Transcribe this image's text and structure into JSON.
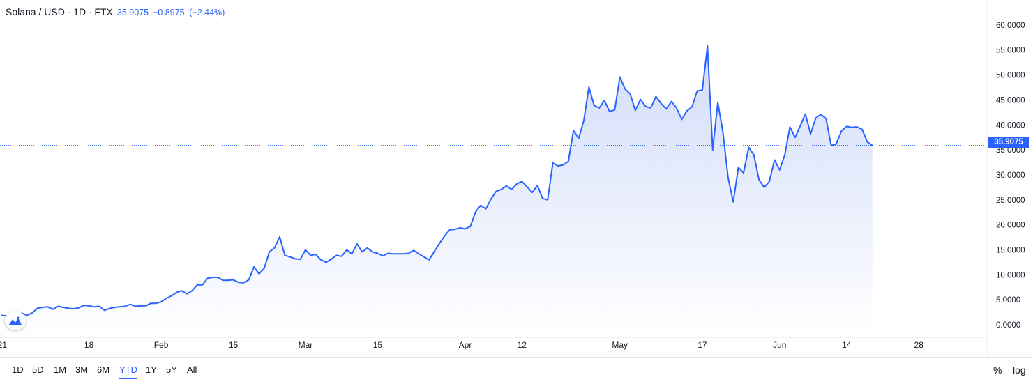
{
  "header": {
    "symbol": "Solana / USD",
    "interval": "1D",
    "exchange": "FTX",
    "last": "35.9075",
    "change": "−0.8975",
    "change_pct": "(−2.44%)"
  },
  "toolbar": {
    "ranges": [
      "1D",
      "5D",
      "1M",
      "3M",
      "6M",
      "YTD",
      "1Y",
      "5Y",
      "All"
    ],
    "active_range": "YTD",
    "percent_label": "%",
    "log_label": "log"
  },
  "price_tag": "35.9075",
  "colors": {
    "line": "#2962ff",
    "fill_top": "#d2dcf9",
    "fill_bottom": "#ffffff",
    "grid": "#e0e3eb",
    "text": "#131722"
  },
  "chart_data": {
    "type": "area",
    "ylim": [
      -2.5,
      65
    ],
    "y_ticks": [
      "60.0000",
      "55.0000",
      "50.0000",
      "45.0000",
      "40.0000",
      "35.0000",
      "30.0000",
      "25.0000",
      "20.0000",
      "15.0000",
      "10.0000",
      "5.0000",
      "0.0000"
    ],
    "x_ticks": [
      {
        "date": "2021-01-01",
        "label": "2021"
      },
      {
        "date": "2021-01-18",
        "label": "18"
      },
      {
        "date": "2021-02-01",
        "label": "Feb"
      },
      {
        "date": "2021-02-15",
        "label": "15"
      },
      {
        "date": "2021-03-01",
        "label": "Mar"
      },
      {
        "date": "2021-03-15",
        "label": "15"
      },
      {
        "date": "2021-04-01",
        "label": "Apr"
      },
      {
        "date": "2021-04-12",
        "label": "12"
      },
      {
        "date": "2021-05-01",
        "label": "May"
      },
      {
        "date": "2021-05-17",
        "label": "17"
      },
      {
        "date": "2021-06-01",
        "label": "Jun"
      },
      {
        "date": "2021-06-14",
        "label": "14"
      },
      {
        "date": "2021-06-28",
        "label": "28"
      }
    ],
    "last_value": 35.9075,
    "series": [
      {
        "x": [
          "2021-01-01",
          "2021-01-02",
          "2021-01-03",
          "2021-01-04",
          "2021-01-05",
          "2021-01-06",
          "2021-01-07",
          "2021-01-08",
          "2021-01-09",
          "2021-01-10",
          "2021-01-11",
          "2021-01-12",
          "2021-01-13",
          "2021-01-14",
          "2021-01-15",
          "2021-01-16",
          "2021-01-17",
          "2021-01-18",
          "2021-01-19",
          "2021-01-20",
          "2021-01-21",
          "2021-01-22",
          "2021-01-23",
          "2021-01-24",
          "2021-01-25",
          "2021-01-26",
          "2021-01-27",
          "2021-01-28",
          "2021-01-29",
          "2021-01-30",
          "2021-01-31",
          "2021-02-01",
          "2021-02-02",
          "2021-02-03",
          "2021-02-04",
          "2021-02-05",
          "2021-02-06",
          "2021-02-07",
          "2021-02-08",
          "2021-02-09",
          "2021-02-10",
          "2021-02-11",
          "2021-02-12",
          "2021-02-13",
          "2021-02-14",
          "2021-02-15",
          "2021-02-16",
          "2021-02-17",
          "2021-02-18",
          "2021-02-19",
          "2021-02-20",
          "2021-02-21",
          "2021-02-22",
          "2021-02-23",
          "2021-02-24",
          "2021-02-25",
          "2021-02-26",
          "2021-02-27",
          "2021-02-28",
          "2021-03-01",
          "2021-03-02",
          "2021-03-03",
          "2021-03-04",
          "2021-03-05",
          "2021-03-06",
          "2021-03-07",
          "2021-03-08",
          "2021-03-09",
          "2021-03-10",
          "2021-03-11",
          "2021-03-12",
          "2021-03-13",
          "2021-03-14",
          "2021-03-15",
          "2021-03-16",
          "2021-03-17",
          "2021-03-18",
          "2021-03-19",
          "2021-03-20",
          "2021-03-21",
          "2021-03-22",
          "2021-03-23",
          "2021-03-24",
          "2021-03-25",
          "2021-03-26",
          "2021-03-27",
          "2021-03-28",
          "2021-03-29",
          "2021-03-30",
          "2021-03-31",
          "2021-04-01",
          "2021-04-02",
          "2021-04-03",
          "2021-04-04",
          "2021-04-05",
          "2021-04-06",
          "2021-04-07",
          "2021-04-08",
          "2021-04-09",
          "2021-04-10",
          "2021-04-11",
          "2021-04-12",
          "2021-04-13",
          "2021-04-14",
          "2021-04-15",
          "2021-04-16",
          "2021-04-17",
          "2021-04-18",
          "2021-04-19",
          "2021-04-20",
          "2021-04-21",
          "2021-04-22",
          "2021-04-23",
          "2021-04-24",
          "2021-04-25",
          "2021-04-26",
          "2021-04-27",
          "2021-04-28",
          "2021-04-29",
          "2021-04-30",
          "2021-05-01",
          "2021-05-02",
          "2021-05-03",
          "2021-05-04",
          "2021-05-05",
          "2021-05-06",
          "2021-05-07",
          "2021-05-08",
          "2021-05-09",
          "2021-05-10",
          "2021-05-11",
          "2021-05-12",
          "2021-05-13",
          "2021-05-14",
          "2021-05-15",
          "2021-05-16",
          "2021-05-17",
          "2021-05-18",
          "2021-05-19",
          "2021-05-20",
          "2021-05-21",
          "2021-05-22",
          "2021-05-23",
          "2021-05-24",
          "2021-05-25",
          "2021-05-26",
          "2021-05-27",
          "2021-05-28",
          "2021-05-29",
          "2021-05-30",
          "2021-05-31",
          "2021-06-01",
          "2021-06-02",
          "2021-06-03",
          "2021-06-04",
          "2021-06-05",
          "2021-06-06",
          "2021-06-07",
          "2021-06-08",
          "2021-06-09",
          "2021-06-10",
          "2021-06-11",
          "2021-06-12",
          "2021-06-13",
          "2021-06-14",
          "2021-06-15",
          "2021-06-16",
          "2021-06-17",
          "2021-06-18",
          "2021-06-19"
        ],
        "values": [
          1.9,
          1.8,
          2.2,
          2.6,
          2.3,
          1.9,
          2.4,
          3.3,
          3.5,
          3.6,
          3.1,
          3.7,
          3.5,
          3.3,
          3.2,
          3.4,
          3.9,
          3.8,
          3.6,
          3.7,
          2.9,
          3.3,
          3.5,
          3.6,
          3.7,
          4.1,
          3.7,
          3.8,
          3.8,
          4.3,
          4.3,
          4.6,
          5.3,
          5.8,
          6.5,
          6.8,
          6.2,
          6.8,
          8.0,
          8.0,
          9.3,
          9.5,
          9.5,
          8.9,
          8.9,
          9.0,
          8.5,
          8.4,
          9.0,
          11.6,
          10.2,
          11.3,
          14.6,
          15.4,
          17.6,
          13.9,
          13.6,
          13.2,
          13.1,
          15.0,
          13.9,
          14.1,
          13.0,
          12.5,
          13.1,
          13.9,
          13.7,
          15.0,
          14.2,
          16.2,
          14.6,
          15.4,
          14.6,
          14.3,
          13.8,
          14.3,
          14.2,
          14.2,
          14.2,
          14.3,
          14.9,
          14.2,
          13.6,
          13.0,
          14.7,
          16.3,
          17.8,
          19.0,
          19.1,
          19.4,
          19.2,
          19.7,
          22.6,
          23.9,
          23.2,
          25.2,
          26.7,
          27.1,
          27.8,
          27.1,
          28.2,
          28.7,
          27.6,
          26.5,
          27.9,
          25.3,
          25.0,
          32.4,
          31.8,
          32.0,
          32.7,
          38.9,
          37.3,
          40.9,
          47.6,
          43.9,
          43.4,
          44.9,
          42.7,
          43.0,
          49.6,
          47.2,
          46.2,
          42.9,
          45.1,
          43.7,
          43.4,
          45.7,
          44.3,
          43.2,
          44.7,
          43.4,
          41.1,
          42.8,
          43.6,
          46.8,
          47.0,
          55.8,
          35.0,
          44.5,
          38.5,
          29.5,
          24.6,
          31.5,
          30.4,
          35.5,
          34.0,
          29.0,
          27.5,
          28.7,
          33.0,
          31.0,
          34.0,
          39.6,
          37.5,
          39.8,
          42.2,
          38.2,
          41.4,
          42.1,
          41.3,
          35.9,
          36.2,
          38.8,
          39.7,
          39.5,
          39.6,
          39.1,
          36.6,
          35.9075
        ]
      }
    ]
  }
}
